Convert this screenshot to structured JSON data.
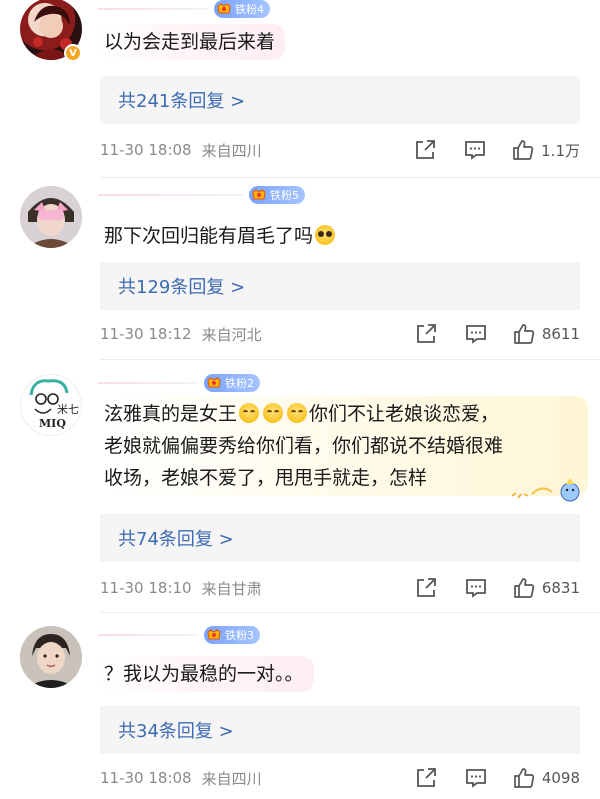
{
  "comments": [
    {
      "fan_badge": "铁粉4",
      "text": "以为会走到最后来着",
      "replies": "共241条回复 >",
      "time": "11-30 18:08",
      "location": "来自四川",
      "likes": "1.1万"
    },
    {
      "fan_badge": "铁粉5",
      "text": "那下次回归能有眉毛了吗",
      "replies": "共129条回复 >",
      "time": "11-30 18:12",
      "location": "来自河北",
      "likes": "8611"
    },
    {
      "fan_badge": "铁粉2",
      "text_line1_a": "泫雅真的是女王",
      "text_line1_b": "你们不让老娘谈恋爱，",
      "text_line2": "老娘就偏偏要秀给你们看，你们都说不结婚很难",
      "text_line3": "收场，老娘不爱了，甩甩手就走，怎样",
      "avatar_text": "米七 MIQ",
      "replies": "共74条回复 >",
      "time": "11-30 18:10",
      "location": "来自甘肃",
      "likes": "6831"
    },
    {
      "fan_badge": "铁粉3",
      "text": "？我以为最稳的一对。。",
      "replies": "共34条回复 >",
      "time": "11-30 18:08",
      "location": "来自四川",
      "likes": "4098"
    }
  ],
  "icons": {
    "share": "share-icon",
    "comment": "comment-icon",
    "like": "thumbs-up-icon"
  },
  "colors": {
    "reply_link": "#3d6bb3",
    "fan_badge": "#7aa3ff",
    "meta_text": "#8a8a8a"
  }
}
